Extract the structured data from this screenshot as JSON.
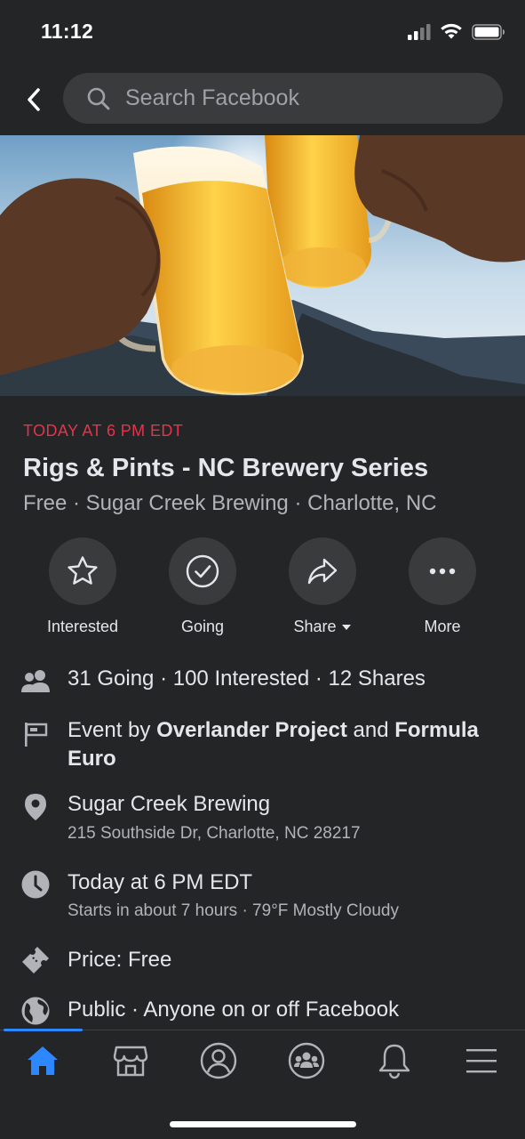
{
  "status_bar": {
    "time": "11:12"
  },
  "search": {
    "placeholder": "Search Facebook"
  },
  "event": {
    "date": "TODAY AT 6 PM EDT",
    "title": "Rigs & Pints - NC Brewery Series",
    "subtitle": "Free · Sugar Creek Brewing · Charlotte, NC"
  },
  "actions": [
    {
      "label": "Interested",
      "icon": "star-icon"
    },
    {
      "label": "Going",
      "icon": "check-circle-icon"
    },
    {
      "label": "Share",
      "icon": "share-arrow-icon"
    },
    {
      "label": "More",
      "icon": "more-dots-icon"
    }
  ],
  "details": {
    "attendance": "31 Going · 100 Interested · 12 Shares",
    "hosts": {
      "prefix": "Event by ",
      "host1": "Overlander Project",
      "connector": " and ",
      "host2": "Formula Euro"
    },
    "location": {
      "name": "Sugar Creek Brewing",
      "address": "215 Southside Dr, Charlotte, NC 28217"
    },
    "time": {
      "main": "Today at 6 PM EDT",
      "sub": "Starts in about 7 hours · 79°F Mostly Cloudy"
    },
    "price": "Price: Free",
    "privacy": "Public · Anyone on or off Facebook"
  },
  "tabbar": {
    "tabs": [
      "home-icon",
      "marketplace-icon",
      "profile-icon",
      "groups-icon",
      "notifications-icon",
      "menu-icon"
    ],
    "active_color": "#2d88ff"
  },
  "colors": {
    "accent_red": "#e4344c",
    "background": "#242526",
    "surface": "#3a3b3c"
  }
}
